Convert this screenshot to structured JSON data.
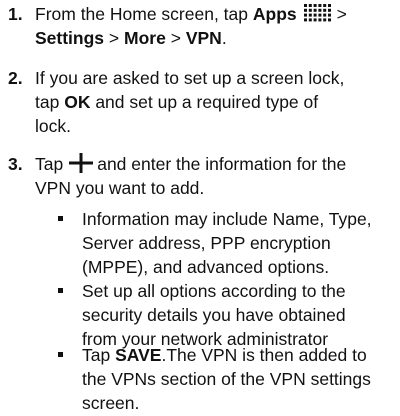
{
  "steps": [
    {
      "number": "1.",
      "prefix": "From the Home screen, tap",
      "apps_label": "Apps",
      "after_icon": ">",
      "path": [
        {
          "label": "Settings",
          "sep": ">"
        },
        {
          "label": "More",
          "sep": ">"
        },
        {
          "label": "VPN",
          "sep": "."
        }
      ]
    },
    {
      "number": "2.",
      "line1": "If you are asked to set up a screen lock,",
      "tap": "tap",
      "ok": "OK",
      "line2_rest": "and set up a required type of",
      "line3": "lock."
    },
    {
      "number": "3.",
      "tap": "Tap",
      "line1_rest": "and enter the information for the",
      "line2": "VPN you want to add."
    }
  ],
  "bullets": [
    {
      "lines": [
        "Information may include Name, Type,",
        "Server address, PPP encryption",
        "(MPPE), and advanced options."
      ]
    },
    {
      "lines": [
        "Set up all options according to the",
        "security details you have obtained",
        "from your network administrator"
      ]
    },
    {
      "tap": "Tap",
      "save": "SAVE",
      "line1_rest": ".The VPN is then added to",
      "line2": "the VPNs section of the VPN settings",
      "line3": "screen."
    }
  ],
  "icons": {
    "apps": "apps-grid-icon",
    "plus": "plus-icon",
    "color": "#111111"
  }
}
